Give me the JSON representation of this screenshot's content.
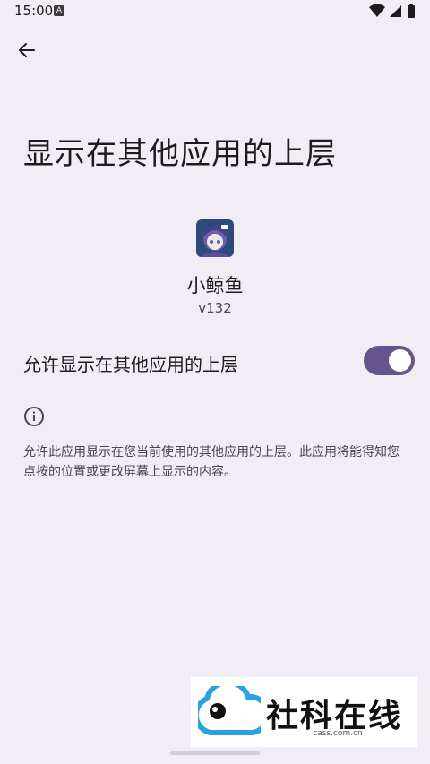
{
  "status_bar": {
    "time": "15:00",
    "notification_icon": "a-icon",
    "icons": [
      "wifi-icon",
      "signal-icon",
      "battery-icon"
    ]
  },
  "header": {
    "back_icon": "arrow-back-icon",
    "title": "显示在其他应用的上层"
  },
  "app": {
    "name": "小鲸鱼",
    "version": "v132"
  },
  "setting": {
    "label": "允许显示在其他应用的上层",
    "enabled": true
  },
  "info": {
    "icon": "info-icon",
    "text": "允许此应用显示在您当前使用的其他应用的上层。此应用将能得知您点按的位置或更改屏幕上显示的内容。"
  },
  "watermark": {
    "brand": "社科在线",
    "url": "cass.com.cn"
  },
  "colors": {
    "background": "#f2ecf4",
    "accent": "#65558f",
    "text_primary": "#1d1b20",
    "text_secondary": "#49454f"
  }
}
